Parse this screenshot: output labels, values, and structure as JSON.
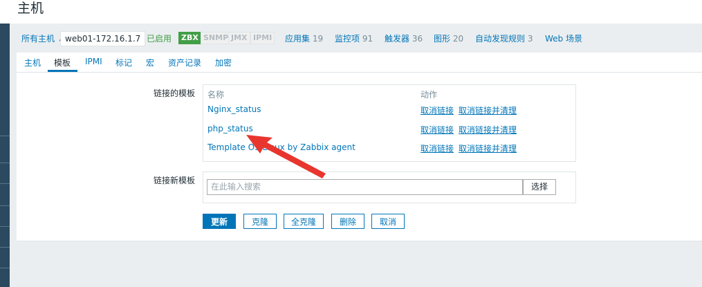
{
  "page": {
    "title": "主机"
  },
  "breadcrumb": {
    "all_hosts": "所有主机",
    "separator": "/",
    "host_name": "web01-172.16.1.7",
    "status": "已启用",
    "badges": {
      "zbx": "ZBX",
      "snmp": "SNMP",
      "jmx": "JMX",
      "ipmi": "IPMI"
    },
    "links": [
      {
        "label": "应用集",
        "count": "19"
      },
      {
        "label": "监控项",
        "count": "91"
      },
      {
        "label": "触发器",
        "count": "36"
      },
      {
        "label": "图形",
        "count": "20"
      },
      {
        "label": "自动发现规则",
        "count": "3"
      },
      {
        "label": "Web 场景",
        "count": ""
      }
    ]
  },
  "tabs": [
    "主机",
    "模板",
    "IPMI",
    "标记",
    "宏",
    "资产记录",
    "加密"
  ],
  "linked_templates": {
    "label": "链接的模板",
    "col_name": "名称",
    "col_action": "动作",
    "rows": [
      {
        "name": "Nginx_status",
        "unlink": "取消链接",
        "unlink_clear": "取消链接并清理"
      },
      {
        "name": "php_status",
        "unlink": "取消链接",
        "unlink_clear": "取消链接并清理"
      },
      {
        "name": "Template OS Linux by Zabbix agent",
        "unlink": "取消链接",
        "unlink_clear": "取消链接并清理"
      }
    ]
  },
  "link_new": {
    "label": "链接新模板",
    "placeholder": "在此输入搜索",
    "select_label": "选择"
  },
  "actions": {
    "update": "更新",
    "clone": "克隆",
    "full_clone": "全克隆",
    "delete": "删除",
    "cancel": "取消"
  },
  "colors": {
    "accent": "#0275b8",
    "enabled": "#429e47",
    "arrow": "#e8352e"
  }
}
